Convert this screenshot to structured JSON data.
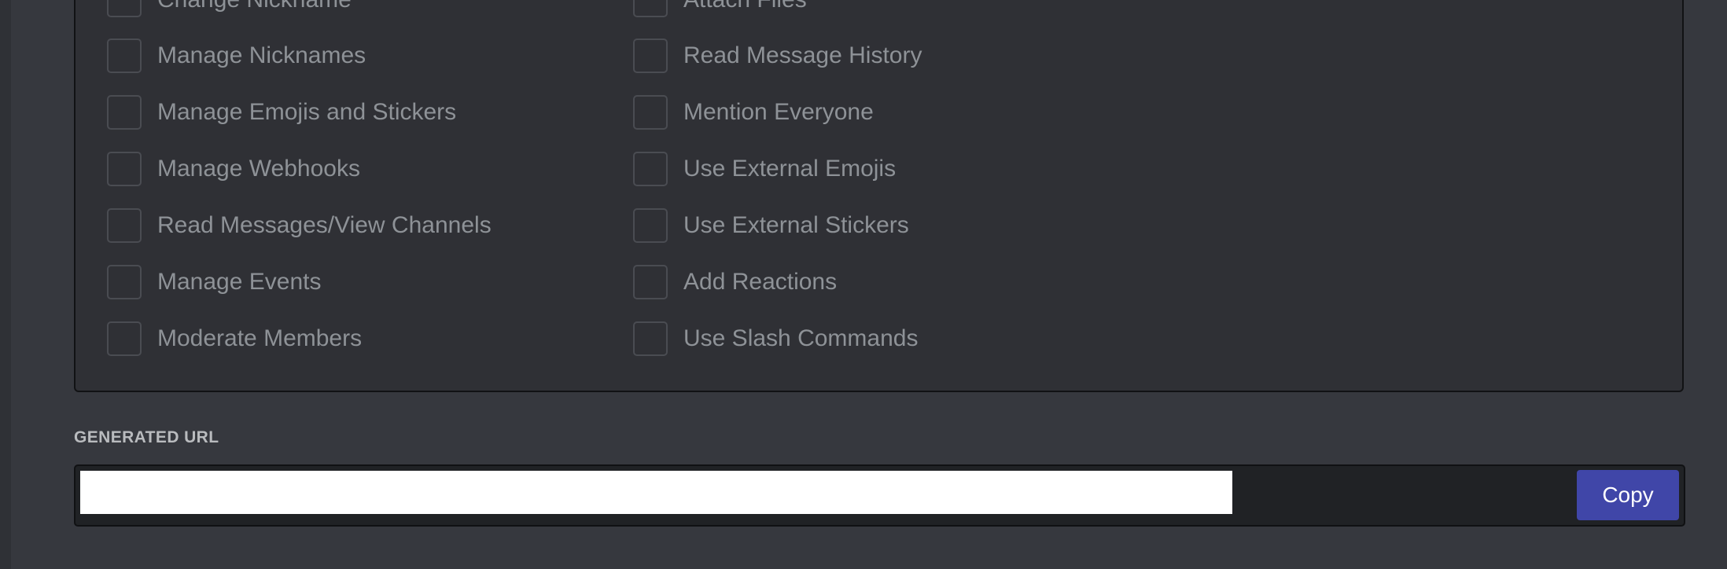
{
  "permissions": {
    "left": [
      {
        "label": "Change Nickname"
      },
      {
        "label": "Manage Nicknames"
      },
      {
        "label": "Manage Emojis and Stickers"
      },
      {
        "label": "Manage Webhooks"
      },
      {
        "label": "Read Messages/View Channels"
      },
      {
        "label": "Manage Events"
      },
      {
        "label": "Moderate Members"
      }
    ],
    "right": [
      {
        "label": "Attach Files"
      },
      {
        "label": "Read Message History"
      },
      {
        "label": "Mention Everyone"
      },
      {
        "label": "Use External Emojis"
      },
      {
        "label": "Use External Stickers"
      },
      {
        "label": "Add Reactions"
      },
      {
        "label": "Use Slash Commands"
      }
    ]
  },
  "generated_url": {
    "label": "GENERATED URL",
    "value": "",
    "copy_label": "Copy"
  },
  "colors": {
    "background": "#36383e",
    "panel": "#2f3035",
    "text_muted": "#8e9297",
    "accent_button": "#4046a8"
  }
}
